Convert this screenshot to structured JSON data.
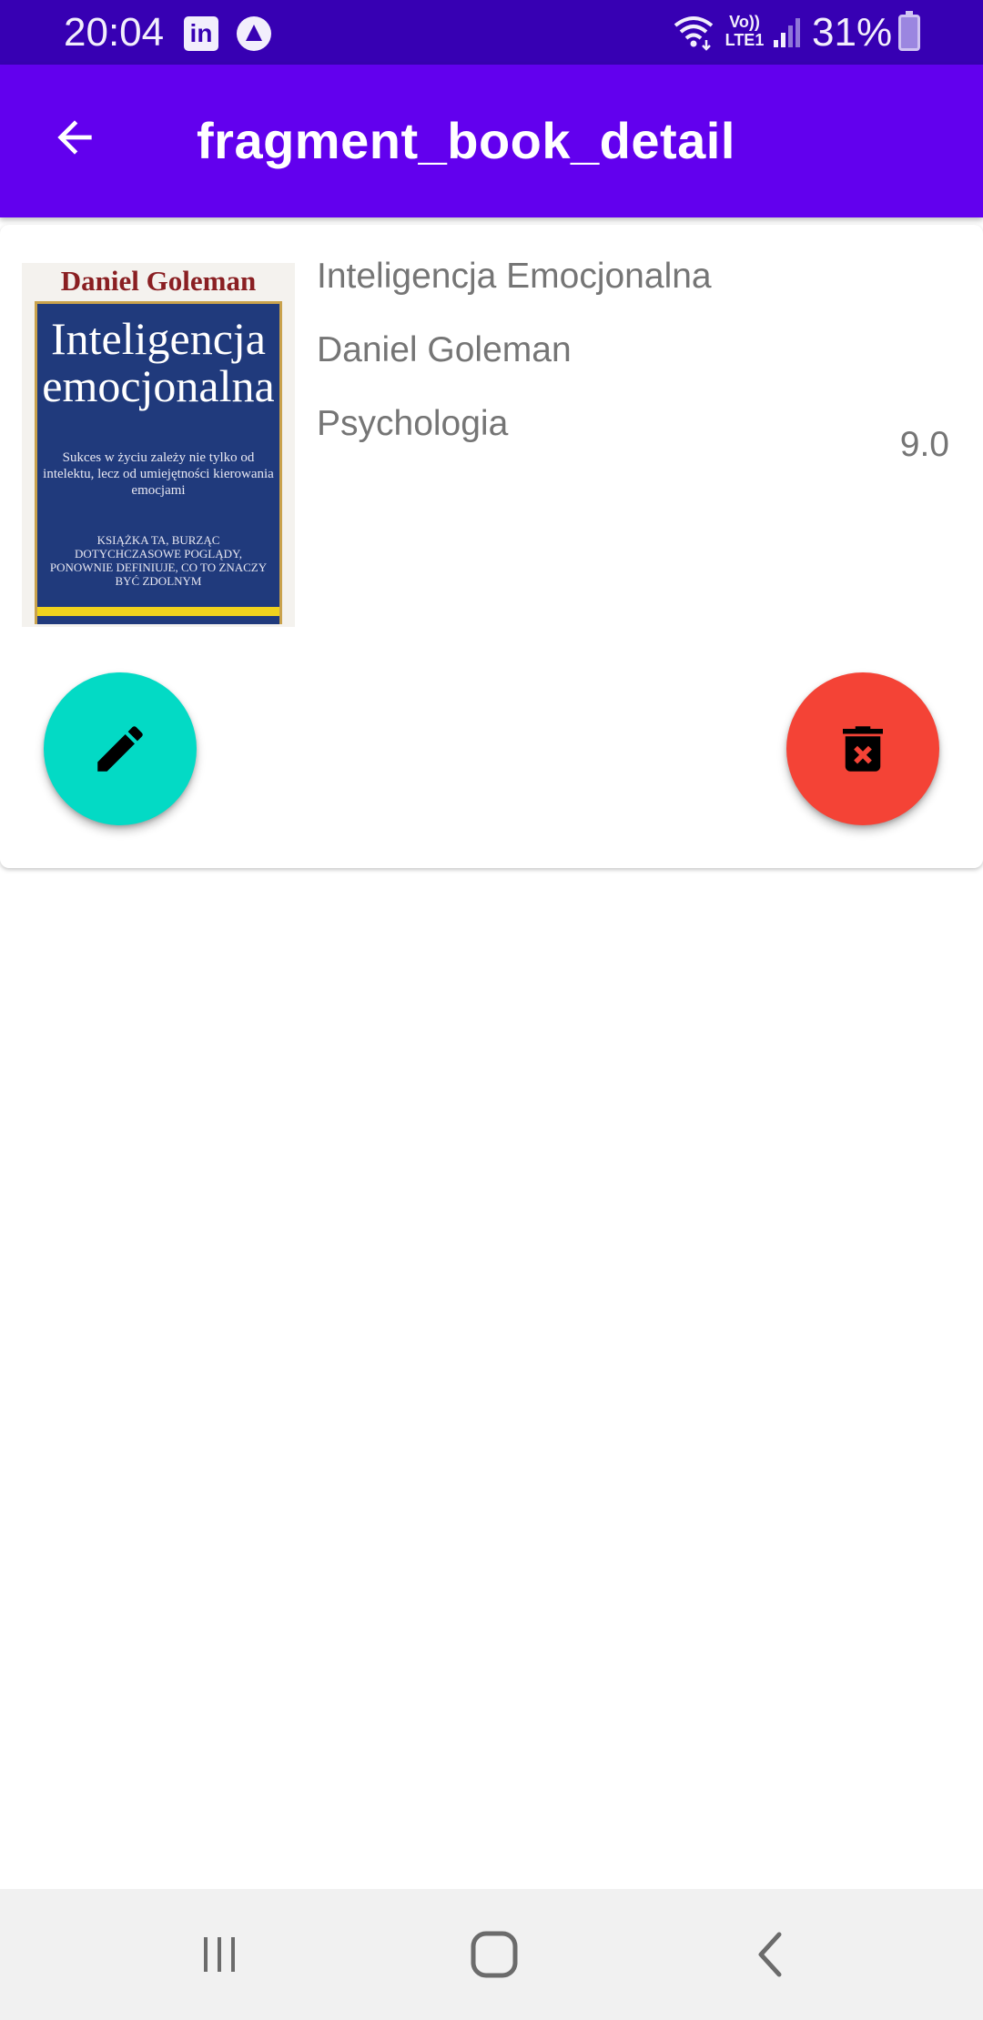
{
  "status_bar": {
    "time": "20:04",
    "linkedin_icon": "linkedin-icon",
    "network_label_top": "Vo))",
    "network_label_bottom": "LTE1",
    "battery_percent": "31%",
    "color": "#3700b3"
  },
  "app_bar": {
    "title": "fragment_book_detail",
    "back_icon": "arrow-back-icon",
    "color": "#6200ee"
  },
  "book": {
    "cover_author": "Daniel Goleman",
    "cover_title_line1": "Inteligencja",
    "cover_title_line2": "emocjonalna",
    "cover_blurb": "Sukces w życiu zależy nie tylko od intelektu, lecz od umiejętności kierowania emocjami",
    "cover_blurb2": "KSIĄŻKA TA, BURZĄC DOTYCHCZASOWE POGLĄDY, PONOWNIE DEFINIUJE, CO TO ZNACZY BYĆ ZDOLNYM",
    "title": "Inteligencja Emocjonalna",
    "author": "Daniel Goleman",
    "genre": "Psychologia",
    "rating": "9.0"
  },
  "actions": {
    "edit_icon": "pencil-icon",
    "edit_color": "#03dac5",
    "delete_icon": "trash-icon",
    "delete_color": "#f44336"
  },
  "nav_bar": {
    "recent_icon": "recent-apps-icon",
    "home_icon": "home-icon",
    "back_icon": "back-chevron-icon"
  }
}
